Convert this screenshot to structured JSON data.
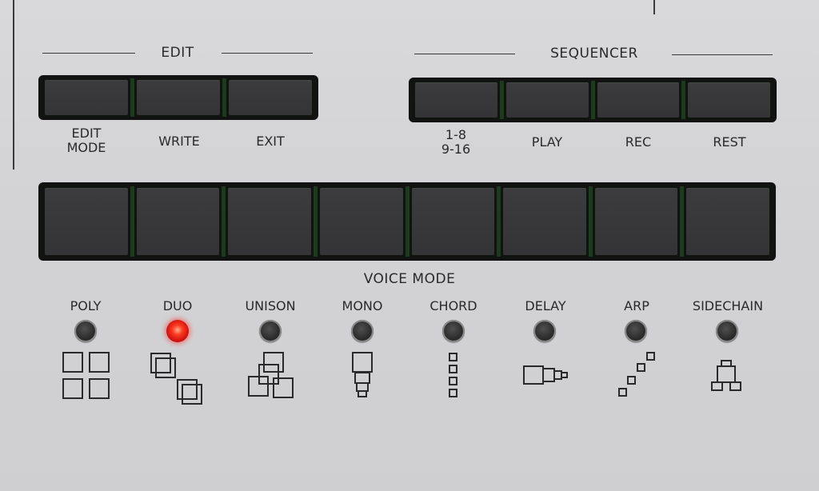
{
  "edit": {
    "title": "EDIT",
    "buttons": [
      {
        "label_line1": "EDIT",
        "label_line2": "MODE"
      },
      {
        "label_line1": "WRITE",
        "label_line2": ""
      },
      {
        "label_line1": "EXIT",
        "label_line2": ""
      }
    ]
  },
  "sequencer": {
    "title": "SEQUENCER",
    "buttons": [
      {
        "label_line1": "1-8",
        "label_line2": "9-16"
      },
      {
        "label_line1": "PLAY",
        "label_line2": ""
      },
      {
        "label_line1": "REC",
        "label_line2": ""
      },
      {
        "label_line1": "REST",
        "label_line2": ""
      }
    ]
  },
  "voice_mode": {
    "title": "VOICE MODE",
    "active_index": 1,
    "led_on_color": "#ff2a1a",
    "modes": [
      {
        "label": "POLY",
        "icon": "poly-icon",
        "led": "off"
      },
      {
        "label": "DUO",
        "icon": "duo-icon",
        "led": "on"
      },
      {
        "label": "UNISON",
        "icon": "unison-icon",
        "led": "off"
      },
      {
        "label": "MONO",
        "icon": "mono-icon",
        "led": "off"
      },
      {
        "label": "CHORD",
        "icon": "chord-icon",
        "led": "off"
      },
      {
        "label": "DELAY",
        "icon": "delay-icon",
        "led": "off"
      },
      {
        "label": "ARP",
        "icon": "arp-icon",
        "led": "off"
      },
      {
        "label": "SIDECHAIN",
        "icon": "sidechain-icon",
        "led": "off"
      }
    ]
  }
}
